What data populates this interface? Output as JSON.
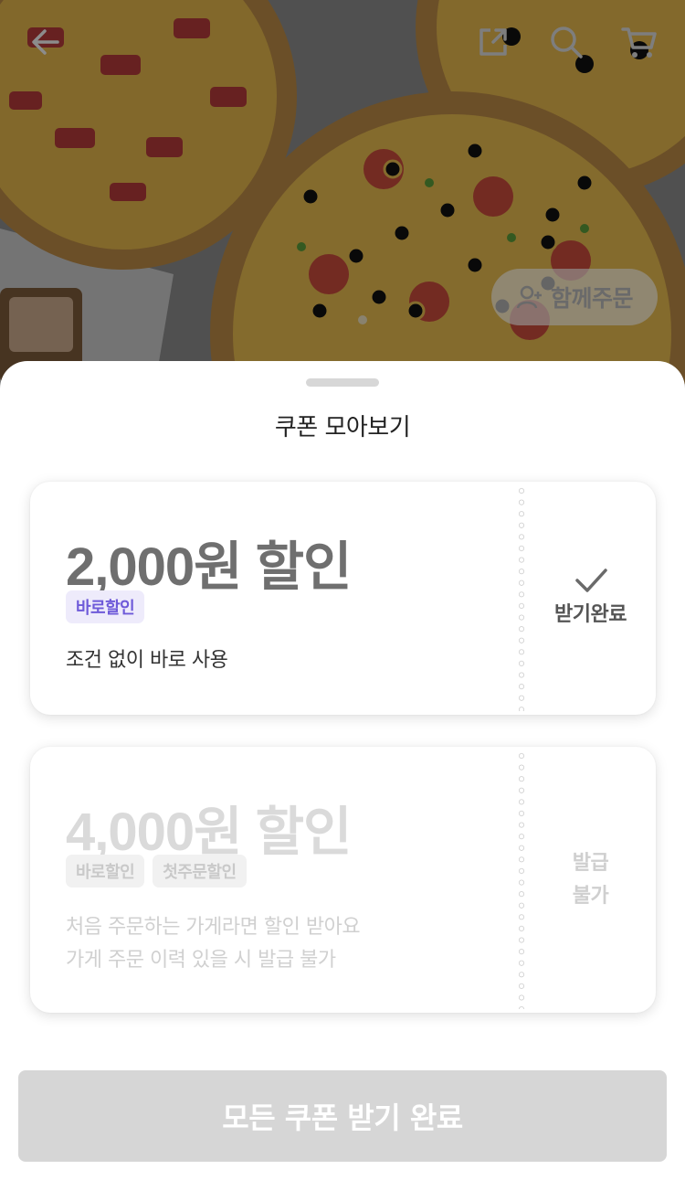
{
  "header": {
    "back_icon": "arrow-left-icon",
    "share_icon": "share-icon",
    "search_icon": "search-icon",
    "cart_icon": "cart-icon",
    "order_together_label": "함께주문",
    "order_together_icon": "add-person-icon"
  },
  "sheet": {
    "title": "쿠폰 모아보기",
    "coupons": [
      {
        "amount": "2,000원 할인",
        "tags": [
          "바로할인"
        ],
        "description": [
          "조건 없이 바로 사용"
        ],
        "status": "받기완료",
        "status_icon": "check-icon",
        "state": "received"
      },
      {
        "amount": "4,000원 할인",
        "tags": [
          "바로할인",
          "첫주문할인"
        ],
        "description": [
          "처음 주문하는 가게라면 할인 받아요",
          "가게 주문 이력 있을 시 발급 불가"
        ],
        "status_lines": [
          "발급",
          "불가"
        ],
        "state": "unavailable"
      }
    ],
    "cta_label": "모든 쿠폰 받기 완료"
  },
  "colors": {
    "accent_purple": "#6e5ad9",
    "tag_purple_bg": "#eeebfb",
    "disabled_text": "#dadada",
    "cta_disabled_bg": "#d6d6d6"
  }
}
